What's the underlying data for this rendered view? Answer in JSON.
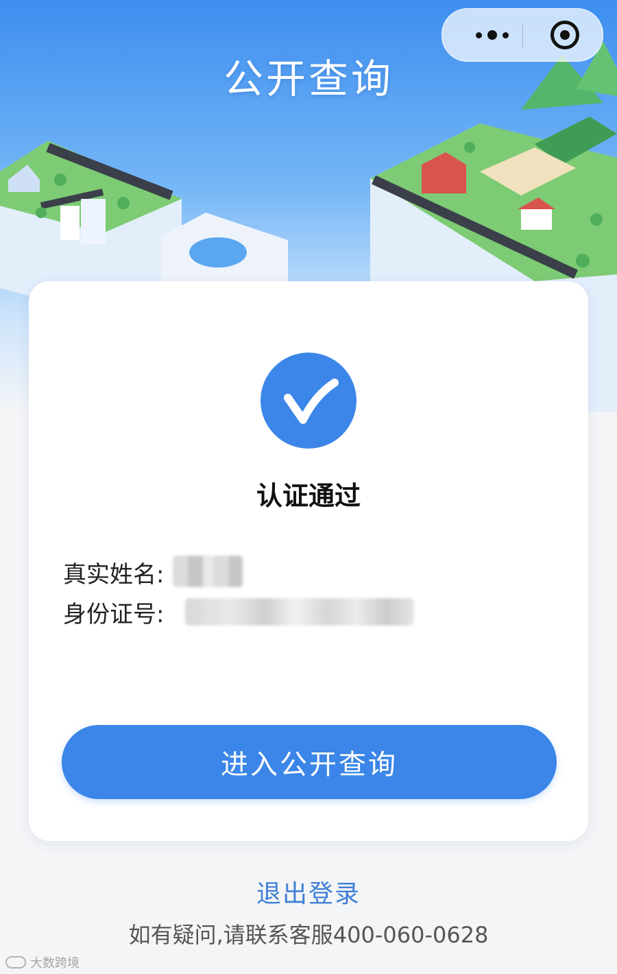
{
  "header": {
    "title": "公开查询",
    "menu_capsule": {
      "more_icon": "more-dots-icon",
      "close_icon": "target-circle-icon"
    }
  },
  "colors": {
    "primary": "#3b86e8",
    "link": "#3f7fd6",
    "hero_top": "#3d8ef0",
    "background": "#f4f5f7"
  },
  "card": {
    "status_icon": "checkmark-icon",
    "status_text": "认证通过",
    "fields": {
      "name_label": "真实姓名:",
      "id_label": "身份证号:"
    },
    "enter_button_label": "进入公开查询"
  },
  "footer": {
    "logout_label": "退出登录",
    "contact_text": "如有疑问,请联系客服400-060-0628"
  },
  "watermark": {
    "text": "大数跨境"
  }
}
